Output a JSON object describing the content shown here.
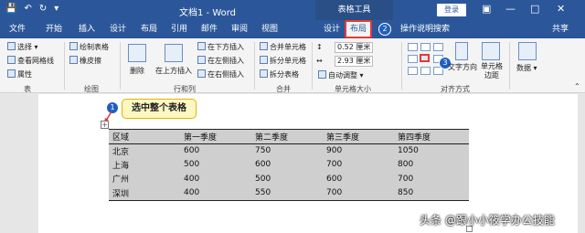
{
  "titlebar": {
    "doc_title": "文档1 - Word",
    "context_tab": "表格工具",
    "login": "登录"
  },
  "tabs": [
    "文件",
    "开始",
    "插入",
    "设计",
    "布局",
    "引用",
    "邮件",
    "审阅",
    "视图",
    "设计",
    "布局",
    "操作说明搜索"
  ],
  "share": "共享",
  "badges": {
    "two": "2",
    "three": "3",
    "one": "1"
  },
  "ribbon": {
    "table_group": {
      "select": "选择",
      "gridlines": "查看网格线",
      "properties": "属性",
      "label": "表"
    },
    "draw_group": {
      "draw_table": "绘制表格",
      "eraser": "橡皮擦",
      "label": "绘图"
    },
    "rows_cols": {
      "delete": "删除",
      "insert_above": "在上方插入",
      "insert_below": "在下方插入",
      "insert_left": "在左侧插入",
      "insert_right": "在右侧插入",
      "label": "行和列"
    },
    "merge": {
      "merge_cells": "合并单元格",
      "split_cells": "拆分单元格",
      "split_table": "拆分表格",
      "label": "合并"
    },
    "cell_size": {
      "height": "0.52 厘米",
      "width": "2.93 厘米",
      "autofit": "自动调整",
      "label": "单元格大小"
    },
    "alignment": {
      "text_direction": "文字方向",
      "cell_margins": "单元格边距",
      "label": "对齐方式"
    },
    "data": {
      "label": "数据"
    }
  },
  "callout": "选中整个表格",
  "table": {
    "headers": [
      "区域",
      "第一季度",
      "第二季度",
      "第三季度",
      "第四季度"
    ],
    "rows": [
      [
        "北京",
        "600",
        "750",
        "900",
        "1050"
      ],
      [
        "上海",
        "500",
        "600",
        "700",
        "800"
      ],
      [
        "广州",
        "400",
        "500",
        "600",
        "700"
      ],
      [
        "深圳",
        "400",
        "550",
        "700",
        "850"
      ]
    ]
  },
  "watermark": "头条 @跟小小筱学办公技能"
}
